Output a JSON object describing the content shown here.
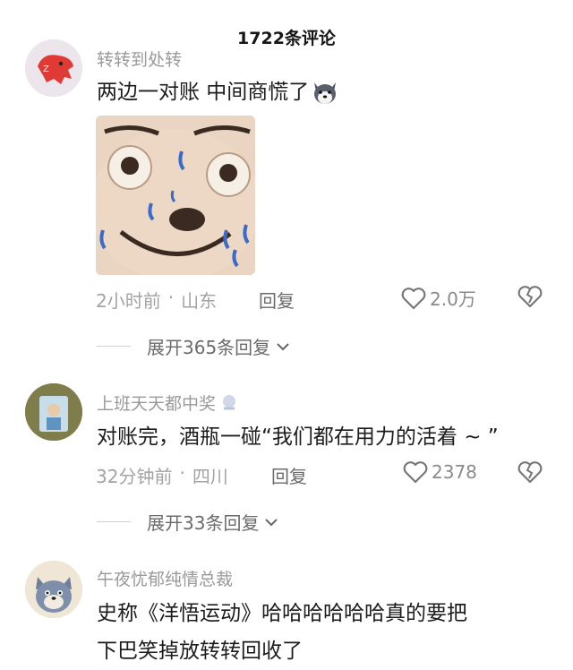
{
  "header": {
    "title": "1722条评论"
  },
  "comments": [
    {
      "username": "转转到处转",
      "text": "两边一对账 中间商慌了",
      "emoji_icon": "husky-dog-emoji-icon",
      "time": "2小时前",
      "location": "山东",
      "reply_label": "回复",
      "likes": "2.0万",
      "expand_label": "展开365条回复"
    },
    {
      "username": "上班天天都中奖",
      "text": "对账完，酒瓶一碰“我们都在用力的活着 ~ ”",
      "time": "32分钟前",
      "location": "四川",
      "reply_label": "回复",
      "likes": "2378",
      "expand_label": "展开33条回复"
    },
    {
      "username": "午夜忧郁纯情总裁",
      "text_line1": "史称《洋悟运动》哈哈哈哈哈哈真的要把",
      "text_line2": "下巴笑掉放转转回收了"
    }
  ],
  "meta_separator": "·",
  "colors": {
    "accent": "#e23b3b",
    "muted": "#a3a3a3"
  }
}
